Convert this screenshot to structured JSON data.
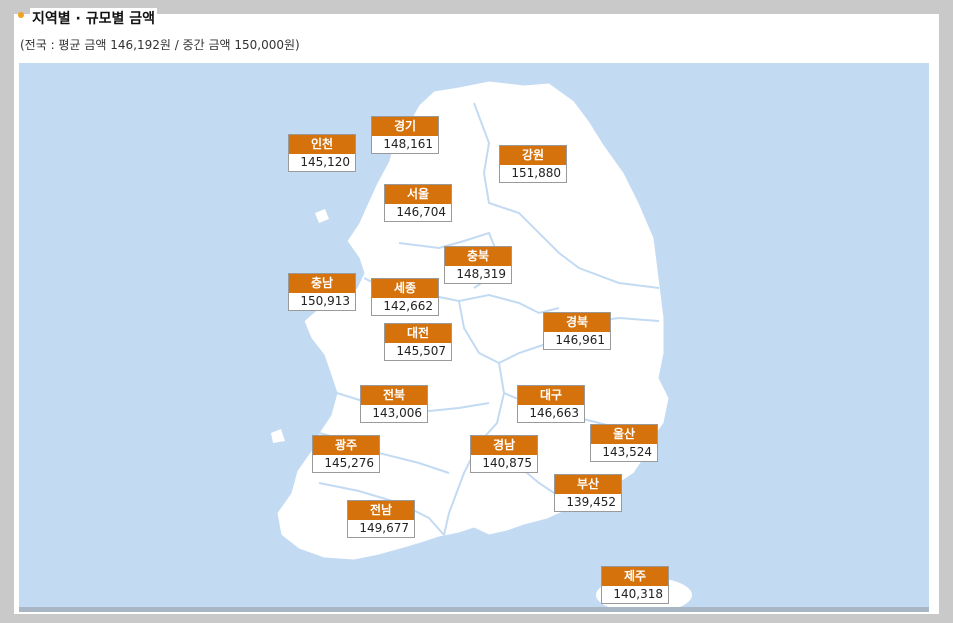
{
  "title": "지역별 · 규모별 금액",
  "subtitle": "(전국 : 평균 금액 146,192원 / 중간 금액 150,000원)",
  "colors": {
    "sea": "#c3daf3",
    "land": "#ffffff",
    "label_header": "#d5720b",
    "bullet": "#f0a21b"
  },
  "regions": [
    {
      "name": "인천",
      "value": "145,120"
    },
    {
      "name": "경기",
      "value": "148,161"
    },
    {
      "name": "강원",
      "value": "151,880"
    },
    {
      "name": "서울",
      "value": "146,704"
    },
    {
      "name": "충북",
      "value": "148,319"
    },
    {
      "name": "충남",
      "value": "150,913"
    },
    {
      "name": "세종",
      "value": "142,662"
    },
    {
      "name": "경북",
      "value": "146,961"
    },
    {
      "name": "대전",
      "value": "145,507"
    },
    {
      "name": "전북",
      "value": "143,006"
    },
    {
      "name": "대구",
      "value": "146,663"
    },
    {
      "name": "울산",
      "value": "143,524"
    },
    {
      "name": "광주",
      "value": "145,276"
    },
    {
      "name": "경남",
      "value": "140,875"
    },
    {
      "name": "부산",
      "value": "139,452"
    },
    {
      "name": "전남",
      "value": "149,677"
    },
    {
      "name": "제주",
      "value": "140,318"
    }
  ]
}
